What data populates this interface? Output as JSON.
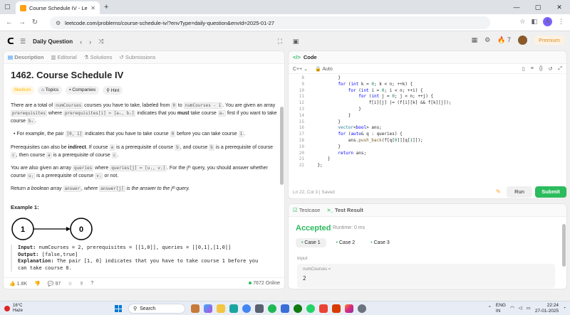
{
  "browser": {
    "tab_title": "Course Schedule IV - LeetCode",
    "url": "leetcode.com/problems/course-schedule-iv/?envType=daily-question&envId=2025-01-27",
    "profile_initial": "A"
  },
  "header": {
    "title": "Daily Question",
    "streak": "7",
    "premium_label": "Premium"
  },
  "left_tabs": {
    "description": "Description",
    "editorial": "Editorial",
    "solutions": "Solutions",
    "submissions": "Submissions"
  },
  "problem": {
    "title": "1462. Course Schedule IV",
    "difficulty": "Medium",
    "tags": [
      "Topics",
      "Companies",
      "Hint"
    ],
    "p1": {
      "a": "There are a total of ",
      "c1": "numCourses",
      "b": " courses you have to take, labeled from ",
      "c2": "0",
      "c": " to ",
      "c3": "numCourses - 1",
      "d": ". You are given an array ",
      "c4": "prerequisites",
      "e": " where ",
      "c5": "prerequisites[i] = [aᵢ, bᵢ]",
      "f": " indicates that you ",
      "must": "must",
      "g": " take course ",
      "c6": "aᵢ",
      "h": " first if you want to take course ",
      "c7": "bᵢ",
      "i": "."
    },
    "bullet": {
      "a": "For example, the pair ",
      "c1": "[0, 1]",
      "b": " indicates that you have to take course ",
      "c2": "0",
      "c": " before you can take course ",
      "c3": "1",
      "d": "."
    },
    "p2": {
      "a": "Prerequisites can also be ",
      "indirect": "indirect",
      "b": ". If course ",
      "c1": "a",
      "c": " is a prerequisite of course ",
      "c2": "b",
      "d": ", and course ",
      "c3": "b",
      "e": " is a prerequisite of course ",
      "c4": "c",
      "f": ", then course ",
      "c5": "a",
      "g": " is a prerequisite of course ",
      "c6": "c",
      "h": "."
    },
    "p3": {
      "a": "You are also given an array ",
      "c1": "queries",
      "b": " where ",
      "c2": "queries[j] = [uⱼ, vⱼ]",
      "c": ". For the ",
      "jth": "jᵗʰ",
      "d": " query, you should answer whether course ",
      "c3": "uⱼ",
      "e": " is a prerequisite of course ",
      "c4": "vⱼ",
      "f": " or not."
    },
    "p4": {
      "a": "Return ",
      "b": "a boolean array ",
      "c1": "answer",
      "c": ", where ",
      "c2": "answer[j]",
      "d": " is the answer to the ",
      "jth": "jᵗʰ",
      "e": " query."
    },
    "example_title": "Example 1:",
    "graph": {
      "node_a": "1",
      "node_b": "0"
    },
    "example": {
      "input_label": "Input:",
      "input": " numCourses = 2, prerequisites = [[1,0]], queries = [[0,1],[1,0]]",
      "output_label": "Output:",
      "output": " [false,true]",
      "expl_label": "Explanation:",
      "expl": " The pair [1, 0] indicates that you have to take course 1 before you",
      "expl2": "can take course 0."
    },
    "likes": "1.8K",
    "comments": "97",
    "online": "7672 Online"
  },
  "code_panel": {
    "tab": "Code",
    "language": "C++",
    "mode": "Auto",
    "lines": [
      {
        "n": "8",
        "t": "            }"
      },
      {
        "n": "9",
        "t": "            for (int k = 0; k < n; ++k) {"
      },
      {
        "n": "10",
        "t": "                for (int i = 0; i < n; ++i) {"
      },
      {
        "n": "11",
        "t": "                    for (int j = 0; j < n; ++j) {"
      },
      {
        "n": "12",
        "t": "                        f[i][j] |= (f[i][k] && f[k][j]);"
      },
      {
        "n": "13",
        "t": "                    }"
      },
      {
        "n": "14",
        "t": "                }"
      },
      {
        "n": "15",
        "t": "            }"
      },
      {
        "n": "16",
        "t": "            vector<bool> ans;"
      },
      {
        "n": "17",
        "t": "            for (auto& q : queries) {"
      },
      {
        "n": "18",
        "t": "                ans.push_back(f[q[0]][q[1]]);"
      },
      {
        "n": "19",
        "t": "            }"
      },
      {
        "n": "20",
        "t": "            return ans;"
      },
      {
        "n": "21",
        "t": "        }"
      },
      {
        "n": "22",
        "t": "    };"
      }
    ],
    "status": "Ln 22, Col 3  |  Saved",
    "run": "Run",
    "submit": "Submit"
  },
  "result": {
    "tab_testcase": "Testcase",
    "tab_result": "Test Result",
    "verdict": "Accepted",
    "runtime": "Runtime: 0 ms",
    "cases": [
      "Case 1",
      "Case 2",
      "Case 3"
    ],
    "input_label": "Input",
    "param_name": "numCourses =",
    "param_value": "2"
  },
  "taskbar": {
    "temp": "16°C",
    "weather": "Haze",
    "search": "Search",
    "lang": "ENG",
    "region": "IN",
    "time": "22:24",
    "date": "27-01-2025"
  }
}
